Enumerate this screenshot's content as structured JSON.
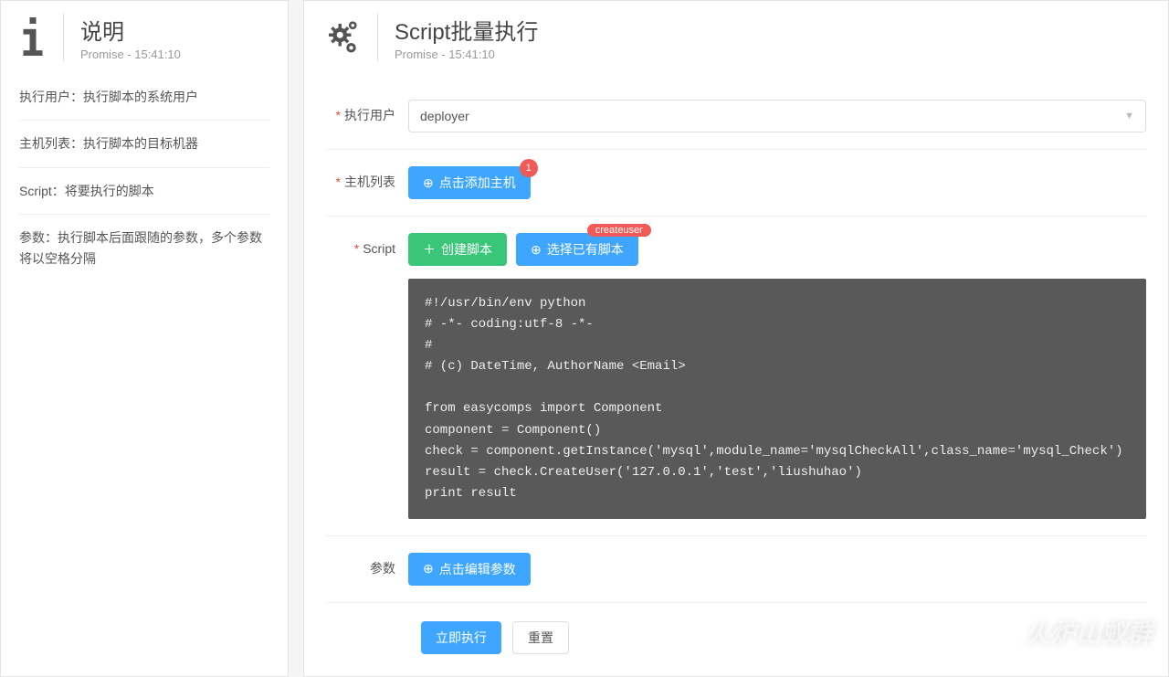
{
  "sidebar": {
    "title": "说明",
    "subtitle": "Promise - 15:41:10",
    "items": [
      "执行用户：执行脚本的系统用户",
      "主机列表：执行脚本的目标机器",
      "Script：将要执行的脚本",
      "参数：执行脚本后面跟随的参数，多个参数将以空格分隔"
    ]
  },
  "main": {
    "title": "Script批量执行",
    "subtitle": "Promise - 15:41:10"
  },
  "form": {
    "user": {
      "label": "执行用户",
      "value": "deployer",
      "required": true
    },
    "hosts": {
      "label": "主机列表",
      "button": "点击添加主机",
      "badge": "1",
      "required": true
    },
    "script": {
      "label": "Script",
      "create_btn": "创建脚本",
      "select_btn": "选择已有脚本",
      "tag": "createuser",
      "required": true,
      "code": "#!/usr/bin/env python\n# -*- coding:utf-8 -*-\n#\n# (c) DateTime, AuthorName <Email>\n\nfrom easycomps import Component\ncomponent = Component()\ncheck = component.getInstance('mysql',module_name='mysqlCheckAll',class_name='mysql_Check')\nresult = check.CreateUser('127.0.0.1','test','liushuhao')\nprint result"
    },
    "params": {
      "label": "参数",
      "button": "点击编辑参数",
      "required": false
    }
  },
  "actions": {
    "execute": "立即执行",
    "reset": "重置"
  },
  "watermark": "火炉山蚁群"
}
